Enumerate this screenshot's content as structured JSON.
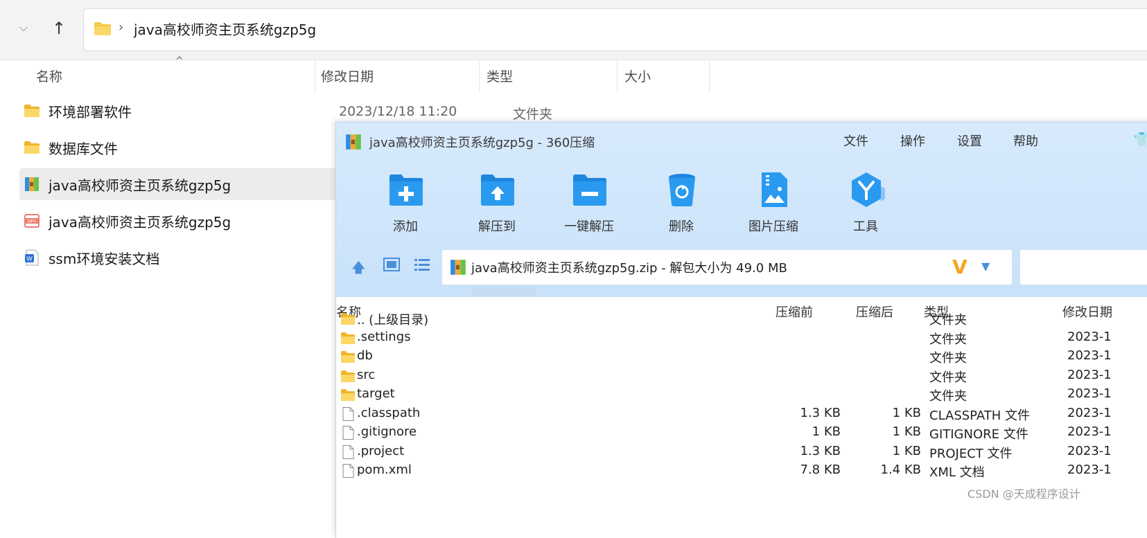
{
  "explorer": {
    "address_path": "java高校师资主页系统gzp5g",
    "columns": {
      "name": "名称",
      "modified": "修改日期",
      "type": "类型",
      "size": "大小"
    },
    "files": [
      {
        "name": "环境部署软件",
        "icon": "folder-icon",
        "modified": "2023/12/18 11:20",
        "type": "文件夹"
      },
      {
        "name": "数据库文件",
        "icon": "folder-icon"
      },
      {
        "name": "java高校师资主页系统gzp5g",
        "icon": "archive-icon",
        "selected": true
      },
      {
        "name": "java高校师资主页系统gzp5g",
        "icon": "mp4-icon"
      },
      {
        "name": "ssm环境安装文档",
        "icon": "word-doc-icon"
      }
    ]
  },
  "zip_window": {
    "title": "java高校师资主页系统gzp5g - 360压缩",
    "menu": [
      "文件",
      "操作",
      "设置",
      "帮助"
    ],
    "tools": [
      {
        "label": "添加",
        "icon": "add-folder-icon"
      },
      {
        "label": "解压到",
        "icon": "extract-to-icon"
      },
      {
        "label": "一键解压",
        "icon": "one-click-extract-icon"
      },
      {
        "label": "删除",
        "icon": "recycle-bin-icon"
      },
      {
        "label": "图片压缩",
        "icon": "image-compress-icon"
      },
      {
        "label": "工具",
        "icon": "tools-icon"
      }
    ],
    "path_text": "java高校师资主页系统gzp5g.zip - 解包大小为 49.0 MB",
    "columns": {
      "name": "名称",
      "before": "压缩前",
      "after": "压缩后",
      "type": "类型",
      "modified": "修改日期"
    },
    "rows": [
      {
        "name": ".. (上级目录)",
        "icon": "folder-icon",
        "before": "",
        "after": "",
        "type": "文件夹",
        "modified": ""
      },
      {
        "name": ".settings",
        "icon": "folder-icon",
        "before": "",
        "after": "",
        "type": "文件夹",
        "modified": "2023-1"
      },
      {
        "name": "db",
        "icon": "folder-icon",
        "before": "",
        "after": "",
        "type": "文件夹",
        "modified": "2023-1"
      },
      {
        "name": "src",
        "icon": "folder-icon",
        "before": "",
        "after": "",
        "type": "文件夹",
        "modified": "2023-1"
      },
      {
        "name": "target",
        "icon": "folder-icon",
        "before": "",
        "after": "",
        "type": "文件夹",
        "modified": "2023-1"
      },
      {
        "name": ".classpath",
        "icon": "file-icon",
        "before": "1.3 KB",
        "after": "1 KB",
        "type": "CLASSPATH 文件",
        "modified": "2023-1"
      },
      {
        "name": ".gitignore",
        "icon": "file-icon",
        "before": "1 KB",
        "after": "1 KB",
        "type": "GITIGNORE 文件",
        "modified": "2023-1"
      },
      {
        "name": ".project",
        "icon": "file-icon",
        "before": "1.3 KB",
        "after": "1 KB",
        "type": "PROJECT 文件",
        "modified": "2023-1"
      },
      {
        "name": "pom.xml",
        "icon": "file-icon",
        "before": "7.8 KB",
        "after": "1.4 KB",
        "type": "XML 文档",
        "modified": "2023-1"
      }
    ]
  },
  "watermark": "CSDN @天成程序设计",
  "colors": {
    "zip_header_bg": "#c9e2fa",
    "accent_blue": "#2a8de9",
    "folder_yellow": "#f7c948"
  }
}
